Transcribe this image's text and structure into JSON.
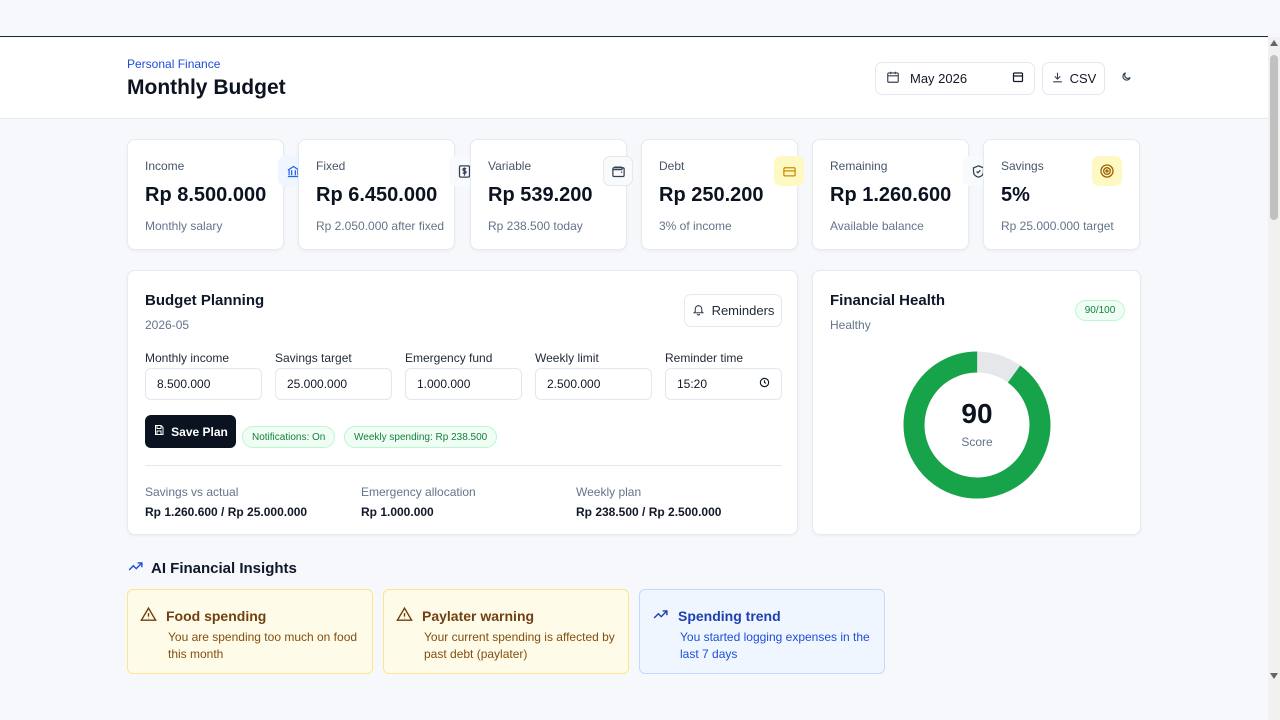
{
  "header": {
    "eyebrow": "Personal Finance",
    "title": "Monthly Budget",
    "month_value": "May 2026",
    "csv_label": "CSV"
  },
  "stats": [
    {
      "label": "Income",
      "value": "Rp 8.500.000",
      "sub": "Monthly salary",
      "icon": "bank-icon",
      "icon_color": "#2563eb"
    },
    {
      "label": "Fixed",
      "value": "Rp 6.450.000",
      "sub": "Rp 2.050.000 after fixed",
      "icon": "dollar-receipt-icon",
      "icon_color": "#334155"
    },
    {
      "label": "Variable",
      "value": "Rp 539.200",
      "sub": "Rp 238.500 today",
      "icon": "wallet-icon",
      "icon_color": "#334155"
    },
    {
      "label": "Debt",
      "value": "Rp 250.200",
      "sub": "3% of income",
      "icon": "credit-card-icon",
      "icon_color": "#ca8a04"
    },
    {
      "label": "Remaining",
      "value": "Rp 1.260.600",
      "sub": "Available balance",
      "icon": "shield-check-icon",
      "icon_color": "#334155"
    },
    {
      "label": "Savings",
      "value": "5%",
      "sub": "Rp 25.000.000 target",
      "icon": "target-icon",
      "icon_color": "#ca8a04"
    }
  ],
  "planning": {
    "title": "Budget Planning",
    "period": "2026-05",
    "reminders_label": "Reminders",
    "fields": [
      {
        "label": "Monthly income",
        "value": "8.500.000"
      },
      {
        "label": "Savings target",
        "value": "25.000.000"
      },
      {
        "label": "Emergency fund",
        "value": "1.000.000"
      },
      {
        "label": "Weekly limit",
        "value": "2.500.000"
      },
      {
        "label": "Reminder time",
        "value": "15:20"
      }
    ],
    "save_label": "Save Plan",
    "notifications_pill": "Notifications: On",
    "weekly_pill": "Weekly spending: Rp 238.500",
    "summary": [
      {
        "label": "Savings vs actual",
        "value": "Rp 1.260.600 / Rp 25.000.000"
      },
      {
        "label": "Emergency allocation",
        "value": "Rp 1.000.000"
      },
      {
        "label": "Weekly plan",
        "value": "Rp 238.500 / Rp 2.500.000"
      }
    ]
  },
  "health": {
    "title": "Financial Health",
    "status": "Healthy",
    "badge": "90/100",
    "score": "90",
    "score_label": "Score",
    "score_value": 90,
    "score_max": 100,
    "ring_color": "#16a34a",
    "track_color": "#e5e7eb"
  },
  "insights": {
    "title": "AI Financial Insights",
    "items": [
      {
        "title": "Food spending",
        "text": "You are spending too much on food this month",
        "icon": "warning-icon",
        "kind": "warn"
      },
      {
        "title": "Paylater warning",
        "text": "Your current spending is affected by past debt (paylater)",
        "icon": "warning-icon",
        "kind": "warn"
      },
      {
        "title": "Spending trend",
        "text": "You started logging expenses in the last 7 days",
        "icon": "trend-up-icon",
        "kind": "info"
      }
    ]
  }
}
